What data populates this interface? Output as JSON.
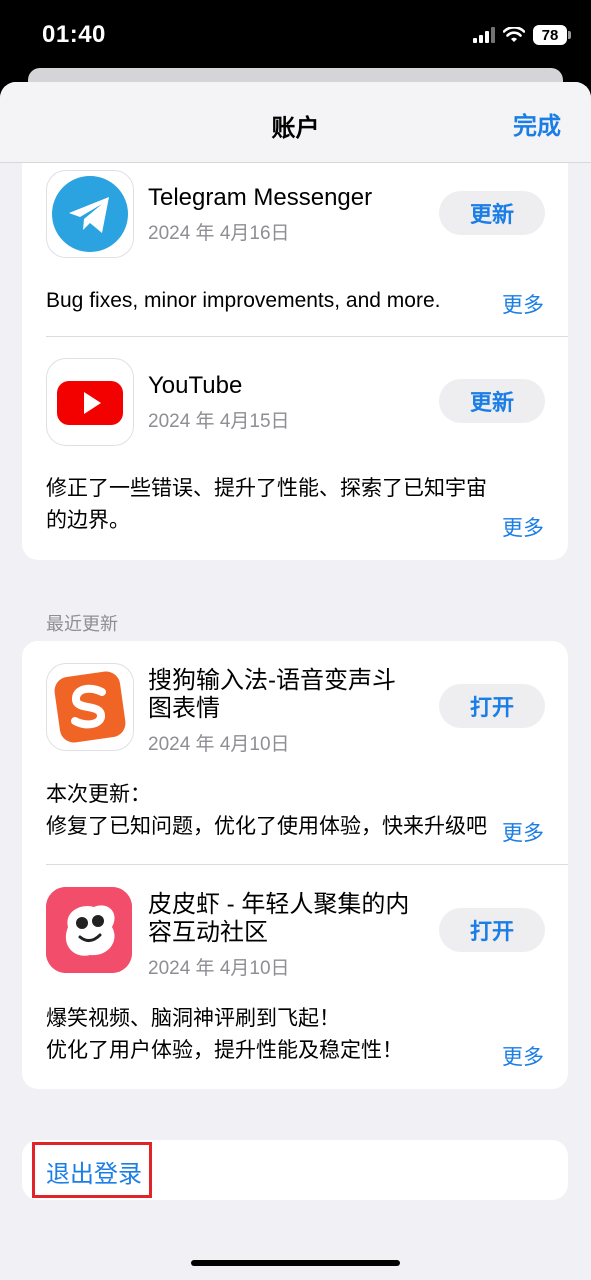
{
  "status_bar": {
    "time": "01:40",
    "battery": "78"
  },
  "nav": {
    "title": "账户",
    "done": "完成"
  },
  "pending_updates": [
    {
      "name": "Telegram Messenger",
      "date": "2024 年 4月16日",
      "button": "更新",
      "notes": "Bug fixes, minor improvements, and more.",
      "more": "更多",
      "icon": "telegram-icon"
    },
    {
      "name": "YouTube",
      "date": "2024 年 4月15日",
      "button": "更新",
      "notes": "修正了一些错误、提升了性能、探索了已知宇宙\n的边界。",
      "more": "更多",
      "icon": "youtube-icon"
    }
  ],
  "recent": {
    "header": "最近更新",
    "apps": [
      {
        "name": "搜狗输入法-语音变声斗图表情",
        "date": "2024 年 4月10日",
        "button": "打开",
        "notes": "本次更新：\n修复了已知问题，优化了使用体验，快来升级吧",
        "more": "更多",
        "icon": "sogou-icon"
      },
      {
        "name": "皮皮虾 - 年轻人聚集的内容互动社区",
        "date": "2024 年 4月10日",
        "button": "打开",
        "notes": "爆笑视频、脑洞神评刷到飞起！\n优化了用户体验，提升性能及稳定性！",
        "more": "更多",
        "icon": "pipixia-icon"
      }
    ]
  },
  "logout": "退出登录",
  "colors": {
    "accent": "#1a7ee6",
    "highlight": "#e0242a"
  }
}
